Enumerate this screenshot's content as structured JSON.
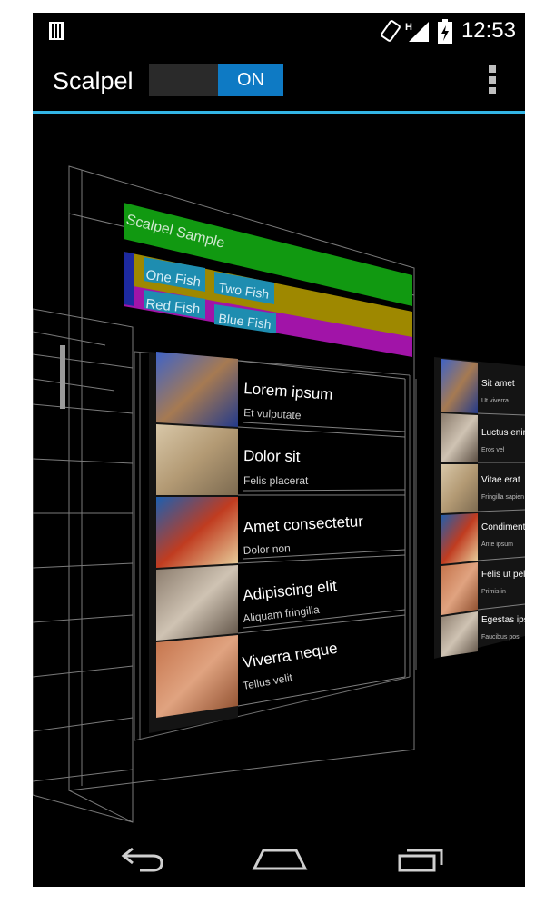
{
  "status_bar": {
    "time": "12:53",
    "network_type": "H",
    "icons": [
      "sim-card-icon",
      "screen-rotation-icon",
      "signal-icon",
      "battery-charging-icon"
    ]
  },
  "action_bar": {
    "title": "Scalpel",
    "toggle_label": "ON",
    "accent_color": "#33b5e5",
    "toggle_color": "#0e7ac4"
  },
  "scene": {
    "sample_title": "Scalpel Sample",
    "fish_labels": [
      "One Fish",
      "Two Fish",
      "Red Fish",
      "Blue Fish"
    ],
    "list_items": [
      {
        "title": "Lorem ipsum",
        "subtitle": "Et vulputate"
      },
      {
        "title": "Dolor sit",
        "subtitle": "Felis placerat"
      },
      {
        "title": "Amet consectetur",
        "subtitle": "Dolor non"
      },
      {
        "title": "Adipiscing elit",
        "subtitle": "Aliquam fringilla"
      },
      {
        "title": "Viverra neque",
        "subtitle": "Tellus velit"
      }
    ],
    "side_items": [
      {
        "title": "Sit amet",
        "subtitle": "Ut viverra"
      },
      {
        "title": "Luctus enim",
        "subtitle": "Eros vel"
      },
      {
        "title": "Vitae erat",
        "subtitle": "Fringilla sapien"
      },
      {
        "title": "Condimentum",
        "subtitle": "Ante ipsum"
      },
      {
        "title": "Felis ut pellent",
        "subtitle": "Primis in"
      },
      {
        "title": "Egestas ipsum",
        "subtitle": "Faucibus pos"
      }
    ],
    "colors": {
      "green": "#119911",
      "gold": "#9e8800",
      "magenta": "#a114a8",
      "blue": "#1d2aa0",
      "cyan": "#1e8db0",
      "wire": "#8a8a8a"
    }
  },
  "nav_bar": {
    "buttons": [
      "back-icon",
      "home-icon",
      "recent-apps-icon"
    ]
  }
}
